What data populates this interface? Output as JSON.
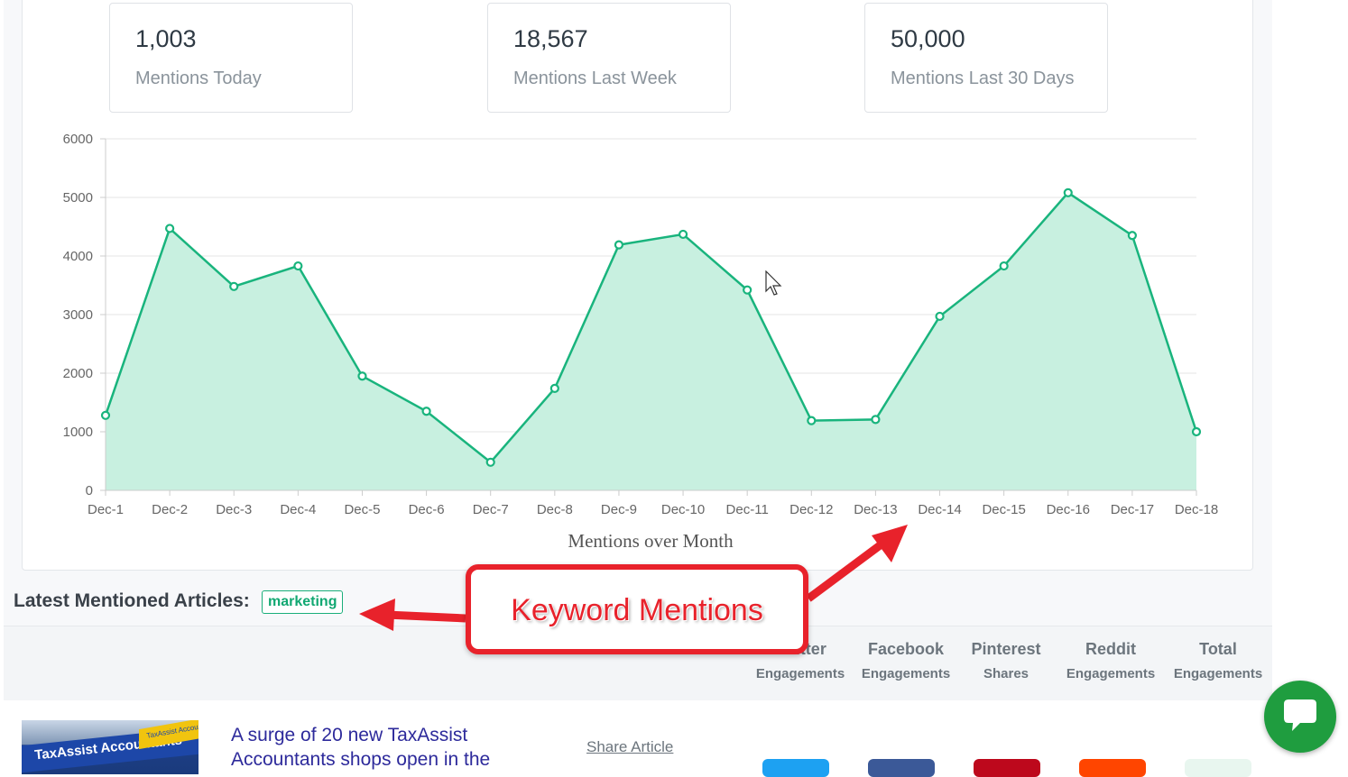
{
  "stats": [
    {
      "value": "1,003",
      "label": "Mentions Today"
    },
    {
      "value": "18,567",
      "label": "Mentions Last Week"
    },
    {
      "value": "50,000",
      "label": "Mentions Last 30 Days"
    }
  ],
  "chart_data": {
    "type": "area",
    "title": "Mentions over Month",
    "categories": [
      "Dec-1",
      "Dec-2",
      "Dec-3",
      "Dec-4",
      "Dec-5",
      "Dec-6",
      "Dec-7",
      "Dec-8",
      "Dec-9",
      "Dec-10",
      "Dec-11",
      "Dec-12",
      "Dec-13",
      "Dec-14",
      "Dec-15",
      "Dec-16",
      "Dec-17",
      "Dec-18"
    ],
    "values": [
      1280,
      4470,
      3480,
      3830,
      1950,
      1350,
      480,
      1740,
      4190,
      4370,
      3420,
      1190,
      1210,
      2970,
      3830,
      5080,
      4350,
      1000
    ],
    "ylim": [
      0,
      6000
    ],
    "yticks": [
      0,
      1000,
      2000,
      3000,
      4000,
      5000,
      6000
    ],
    "grid": true,
    "colors": {
      "line": "#19b47d",
      "fill": "#c8f0e0",
      "point_fill": "#ffffff"
    }
  },
  "articles_section": {
    "heading": "Latest Mentioned Articles:",
    "keyword": "marketing"
  },
  "table_columns": [
    {
      "line1": "Twitter",
      "line2": "Engagements"
    },
    {
      "line1": "Facebook",
      "line2": "Engagements"
    },
    {
      "line1": "Pinterest",
      "line2": "Shares"
    },
    {
      "line1": "Reddit",
      "line2": "Engagements"
    },
    {
      "line1": "Total",
      "line2": "Engagements"
    }
  ],
  "article": {
    "title": "A surge of 20 new TaxAssist Accountants shops open in the",
    "share_label": "Share Article",
    "thumbnail_text": "TaxAssist Accountants",
    "thumbnail_banner": "TaxAssist Accountants"
  },
  "share_buttons": [
    {
      "name": "twitter",
      "color": "#1da1f2"
    },
    {
      "name": "facebook",
      "color": "#3b5998"
    },
    {
      "name": "pinterest",
      "color": "#bd081c"
    },
    {
      "name": "reddit",
      "color": "#ff4500"
    },
    {
      "name": "total",
      "color": "#e8f6ef"
    }
  ],
  "annotation": {
    "label": "Keyword Mentions",
    "color": "#e8222b"
  },
  "chat": {
    "icon": "chat-bubble-icon",
    "color": "#1f9d3f"
  }
}
